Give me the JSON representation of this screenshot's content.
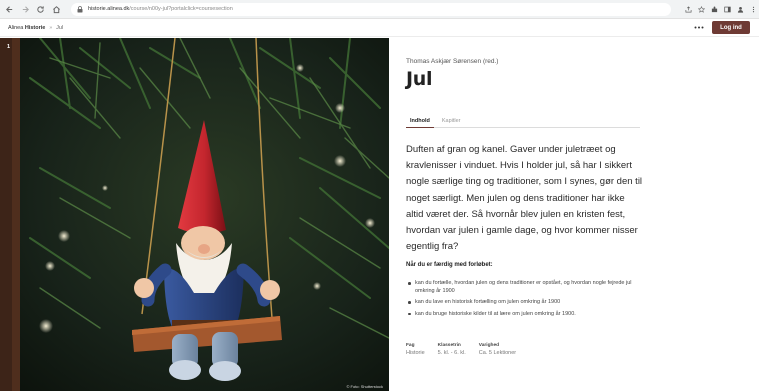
{
  "browser": {
    "url_host": "historie.alinea.dk",
    "url_path": "/course/n00y-jul?portalclick=coursesection",
    "icons": [
      "back-icon",
      "forward-icon",
      "reload-icon",
      "home-icon",
      "lock-icon",
      "share-icon",
      "star-icon",
      "extensions-icon",
      "sidebar-icon",
      "profile-icon",
      "menu-icon"
    ]
  },
  "header": {
    "brand_prefix": "Alinea ",
    "brand_name": "Historie",
    "separator": "»",
    "current": "Jul",
    "more_label": "•••",
    "login_label": "Log ind"
  },
  "hero": {
    "index_number": "1",
    "photo_credit": "© Foto: Shutterstock"
  },
  "course": {
    "author": "Thomas Askjær Sørensen (red.)",
    "title": "Jul",
    "tabs": [
      {
        "label": "Indhold",
        "active": true
      },
      {
        "label": "Kapitler",
        "active": false
      }
    ],
    "intro": "Duften af gran og kanel. Gaver under juletræet og kravlenisser i vinduet. Hvis I holder jul, så har I sikkert nogle særlige ting og traditioner, som I synes, gør den til noget særligt. Men julen og dens traditioner har ikke altid været der. Så hvornår blev julen en kristen fest, hvordan var julen i gamle dage, og hvor kommer nisser egentlig fra?",
    "goals_title": "Når du er færdig med forløbet:",
    "goals": [
      "kan du fortælle, hvordan julen og dens traditioner er opstået, og hvordan nogle fejrede jul omkring år 1900",
      "kan du lave en historisk fortælling om julen omkring år 1900",
      "kan du bruge historiske kilder til at lære om julen omkring år 1900."
    ],
    "meta": [
      {
        "label": "Fag",
        "value": "Historie"
      },
      {
        "label": "Klassetrin",
        "value": "5. kl. - 6. kl."
      },
      {
        "label": "Varighed",
        "value": "Ca. 5 Lektioner"
      }
    ]
  },
  "colors": {
    "accent": "#6e3a34",
    "browser_bar": "#f1f3f4",
    "gnome_hat": "#c4262e",
    "gnome_shirt": "#2e4a8a",
    "foliage": "#2f5a2a"
  }
}
